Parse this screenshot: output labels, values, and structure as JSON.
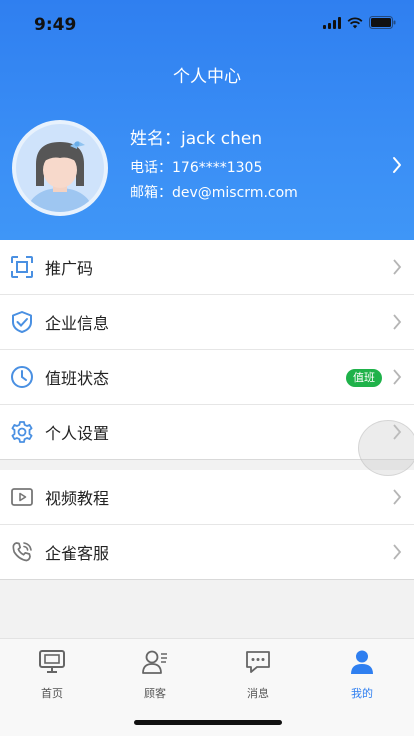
{
  "status_bar": {
    "time": "9:49"
  },
  "header": {
    "title": "个人中心"
  },
  "profile": {
    "name_label": "姓名：jack chen",
    "phone_label": "电话：176****1305",
    "email_label": "邮箱：dev@miscrm.com"
  },
  "menu_primary": [
    {
      "label": "推广码",
      "icon": "qr-scan-icon"
    },
    {
      "label": "企业信息",
      "icon": "shield-check-icon"
    },
    {
      "label": "值班状态",
      "icon": "clock-icon",
      "badge": "值班"
    },
    {
      "label": "个人设置",
      "icon": "gear-icon"
    }
  ],
  "menu_secondary": [
    {
      "label": "视频教程",
      "icon": "video-play-icon"
    },
    {
      "label": "企雀客服",
      "icon": "phone-icon"
    }
  ],
  "tabbar": [
    {
      "label": "首页",
      "icon": "monitor-icon"
    },
    {
      "label": "顾客",
      "icon": "customer-icon"
    },
    {
      "label": "消息",
      "icon": "chat-icon"
    },
    {
      "label": "我的",
      "icon": "person-icon",
      "active": true
    }
  ],
  "colors": {
    "brand": "#2f7ff0",
    "badge": "#1fb24a",
    "icon_blue": "#4a90e2"
  }
}
